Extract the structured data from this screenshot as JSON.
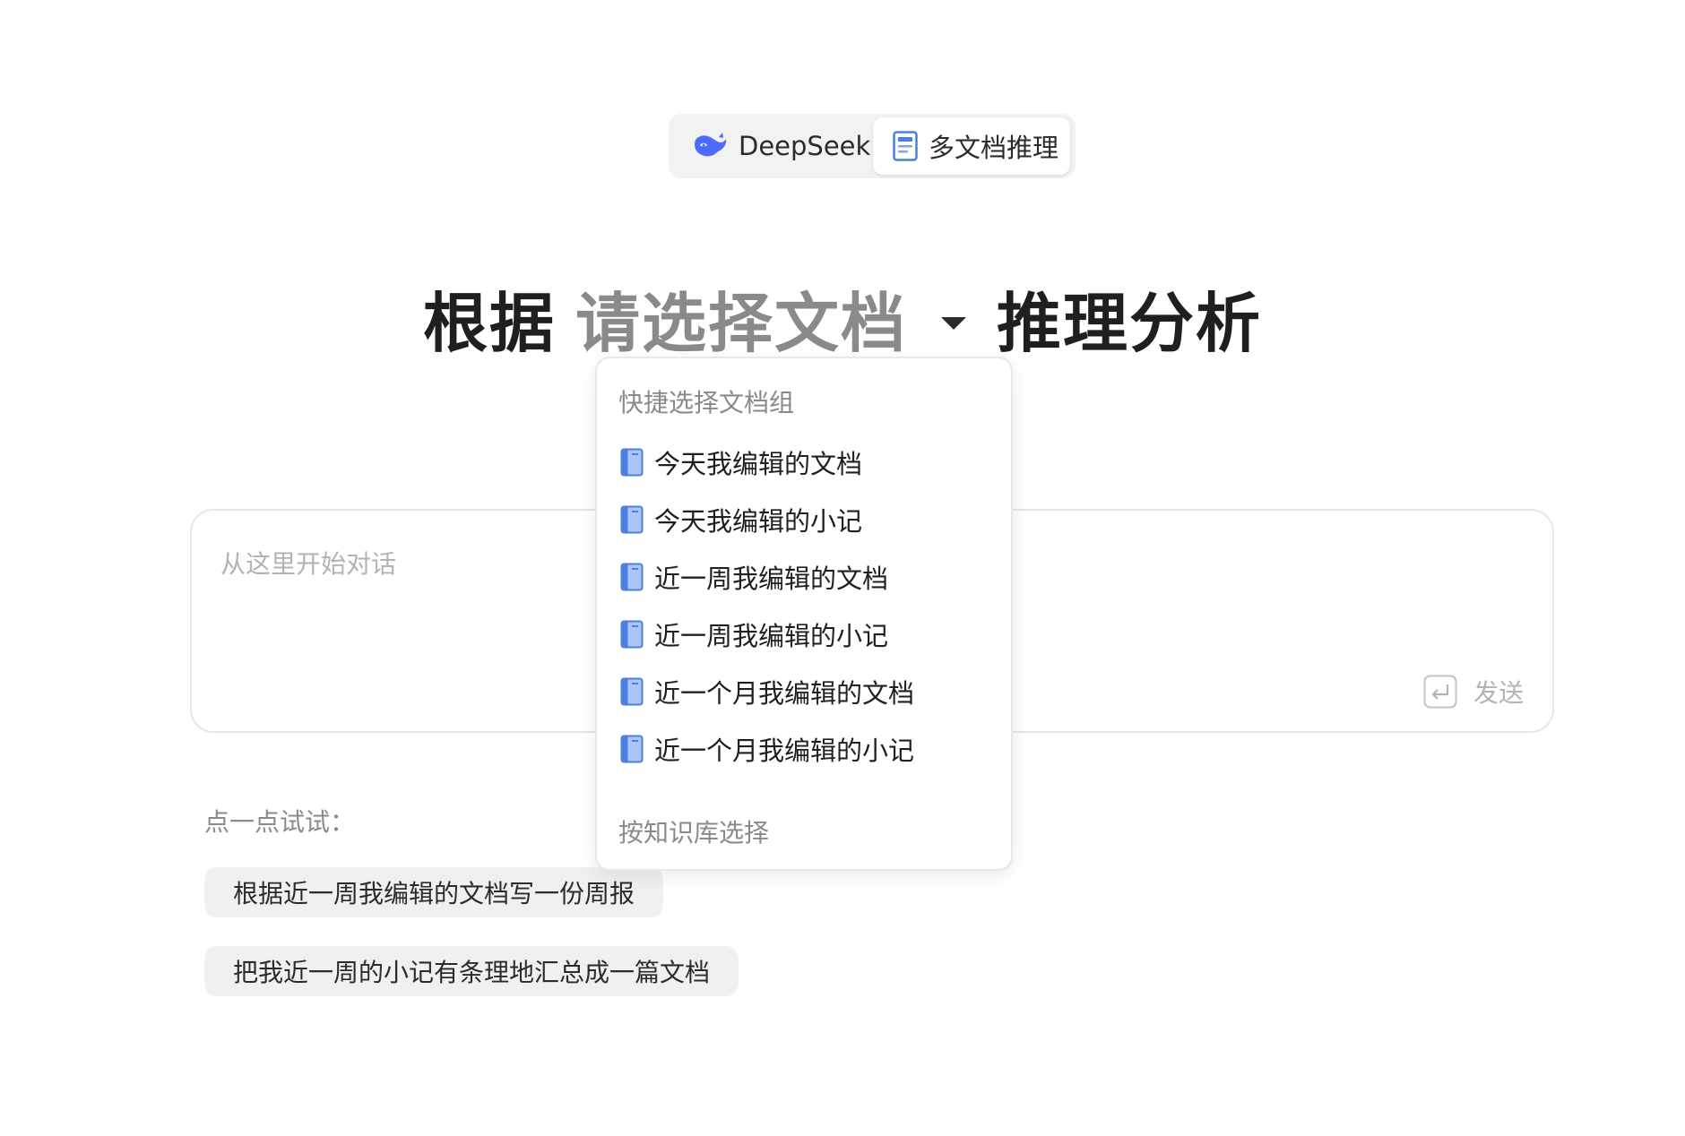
{
  "mode_switch": {
    "tabs": [
      {
        "label": "DeepSeek",
        "icon": "whale-icon",
        "selected": false
      },
      {
        "label": "多文档推理",
        "icon": "document-icon",
        "selected": true
      }
    ]
  },
  "headline": {
    "prefix": "根据",
    "select_placeholder": "请选择文档",
    "suffix": "推理分析"
  },
  "dropdown": {
    "section_quick": "快捷选择文档组",
    "items": [
      {
        "label": "今天我编辑的文档",
        "icon": "book-icon"
      },
      {
        "label": "今天我编辑的小记",
        "icon": "book-icon"
      },
      {
        "label": "近一周我编辑的文档",
        "icon": "book-icon"
      },
      {
        "label": "近一周我编辑的小记",
        "icon": "book-icon"
      },
      {
        "label": "近一个月我编辑的文档",
        "icon": "book-icon"
      },
      {
        "label": "近一个月我编辑的小记",
        "icon": "book-icon"
      }
    ],
    "section_kb": "按知识库选择"
  },
  "chat": {
    "placeholder": "从这里开始对话",
    "send_label": "发送"
  },
  "suggestions": {
    "label": "点一点试试：",
    "chips": [
      "根据近一周我编辑的文档写一份周报",
      "把我近一周的小记有条理地汇总成一篇文档"
    ]
  },
  "colors": {
    "accent_blue": "#4a7fe0",
    "deepseek_blue": "#4d6bfe",
    "placeholder_gray": "#8a8a8a",
    "chip_bg": "#f0f0f0"
  }
}
